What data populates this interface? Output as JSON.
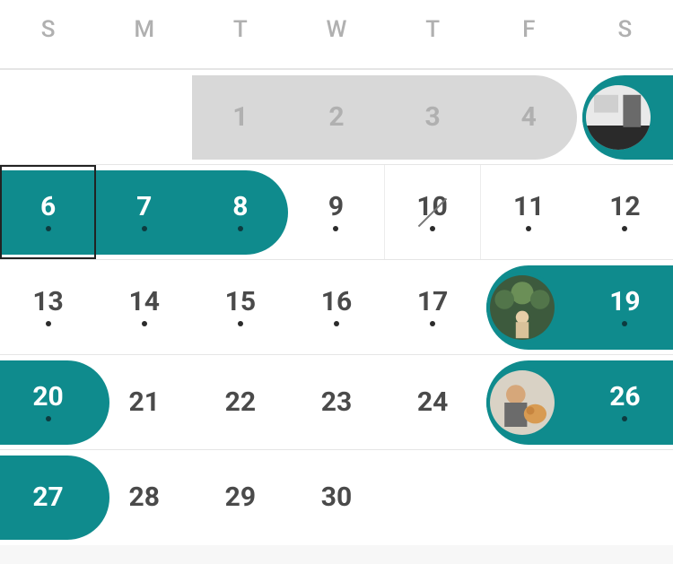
{
  "accentColor": "#0f8b8d",
  "weekdays": [
    "S",
    "M",
    "T",
    "W",
    "T",
    "F",
    "S"
  ],
  "rows": [
    {
      "cells": [
        {
          "num": null,
          "hasDot": false,
          "sel": false,
          "prev": false,
          "strike": false,
          "today": false,
          "sep": false
        },
        {
          "num": null,
          "hasDot": false,
          "sel": false,
          "prev": false,
          "strike": false,
          "today": false,
          "sep": false
        },
        {
          "num": "1",
          "hasDot": false,
          "sel": false,
          "prev": true,
          "strike": false,
          "today": false,
          "sep": false
        },
        {
          "num": "2",
          "hasDot": false,
          "sel": false,
          "prev": true,
          "strike": false,
          "today": false,
          "sep": false
        },
        {
          "num": "3",
          "hasDot": false,
          "sel": false,
          "prev": true,
          "strike": false,
          "today": false,
          "sep": false
        },
        {
          "num": "4",
          "hasDot": false,
          "sel": false,
          "prev": true,
          "strike": false,
          "today": false,
          "sep": false
        },
        {
          "num": null,
          "hasDot": false,
          "sel": false,
          "prev": false,
          "strike": false,
          "today": false,
          "sep": false
        }
      ],
      "pills": [
        {
          "startCol": 2,
          "endCol": 5,
          "color": "grey",
          "roundRight": true,
          "roundLeft": false,
          "avatar": null
        },
        {
          "startCol": 6,
          "endCol": 6,
          "color": "accent",
          "roundRight": false,
          "roundLeft": true,
          "fullRight": true,
          "avatar": "kitchen"
        }
      ]
    },
    {
      "cells": [
        {
          "num": "6",
          "hasDot": true,
          "sel": true,
          "prev": false,
          "strike": false,
          "today": true,
          "sep": false
        },
        {
          "num": "7",
          "hasDot": true,
          "sel": true,
          "prev": false,
          "strike": false,
          "today": false,
          "sep": false
        },
        {
          "num": "8",
          "hasDot": true,
          "sel": true,
          "prev": false,
          "strike": false,
          "today": false,
          "sep": false
        },
        {
          "num": "9",
          "hasDot": true,
          "sel": false,
          "prev": false,
          "strike": false,
          "today": false,
          "sep": true
        },
        {
          "num": "10",
          "hasDot": true,
          "sel": false,
          "prev": false,
          "strike": true,
          "today": false,
          "sep": true
        },
        {
          "num": "11",
          "hasDot": true,
          "sel": false,
          "prev": false,
          "strike": false,
          "today": false,
          "sep": false
        },
        {
          "num": "12",
          "hasDot": true,
          "sel": false,
          "prev": false,
          "strike": false,
          "today": false,
          "sep": false
        }
      ],
      "pills": [
        {
          "startCol": 0,
          "endCol": 2,
          "color": "accent",
          "roundRight": true,
          "roundLeft": false,
          "avatar": null
        }
      ]
    },
    {
      "cells": [
        {
          "num": "13",
          "hasDot": true,
          "sel": false,
          "prev": false,
          "strike": false,
          "today": false,
          "sep": false
        },
        {
          "num": "14",
          "hasDot": true,
          "sel": false,
          "prev": false,
          "strike": false,
          "today": false,
          "sep": false
        },
        {
          "num": "15",
          "hasDot": true,
          "sel": false,
          "prev": false,
          "strike": false,
          "today": false,
          "sep": false
        },
        {
          "num": "16",
          "hasDot": true,
          "sel": false,
          "prev": false,
          "strike": false,
          "today": false,
          "sep": false
        },
        {
          "num": "17",
          "hasDot": true,
          "sel": false,
          "prev": false,
          "strike": false,
          "today": false,
          "sep": false
        },
        {
          "num": null,
          "hasDot": true,
          "sel": true,
          "prev": false,
          "strike": false,
          "today": false,
          "sep": false
        },
        {
          "num": "19",
          "hasDot": true,
          "sel": true,
          "prev": false,
          "strike": false,
          "today": false,
          "sep": false
        }
      ],
      "pills": [
        {
          "startCol": 5,
          "endCol": 6,
          "color": "accent",
          "roundRight": false,
          "roundLeft": true,
          "fullRight": true,
          "avatar": "outdoor"
        }
      ]
    },
    {
      "cells": [
        {
          "num": "20",
          "hasDot": true,
          "sel": true,
          "prev": false,
          "strike": false,
          "today": false,
          "sep": false
        },
        {
          "num": "21",
          "hasDot": false,
          "sel": false,
          "prev": false,
          "strike": false,
          "today": false,
          "sep": false
        },
        {
          "num": "22",
          "hasDot": false,
          "sel": false,
          "prev": false,
          "strike": false,
          "today": false,
          "sep": false
        },
        {
          "num": "23",
          "hasDot": false,
          "sel": false,
          "prev": false,
          "strike": false,
          "today": false,
          "sep": false
        },
        {
          "num": "24",
          "hasDot": false,
          "sel": false,
          "prev": false,
          "strike": false,
          "today": false,
          "sep": false
        },
        {
          "num": null,
          "hasDot": true,
          "sel": true,
          "prev": false,
          "strike": false,
          "today": false,
          "sep": false
        },
        {
          "num": "26",
          "hasDot": true,
          "sel": true,
          "prev": false,
          "strike": false,
          "today": false,
          "sep": false
        }
      ],
      "pills": [
        {
          "startCol": 0,
          "endCol": 0,
          "color": "accent",
          "roundRight": true,
          "roundLeft": false,
          "avatar": null,
          "extend": 15
        },
        {
          "startCol": 5,
          "endCol": 6,
          "color": "accent",
          "roundRight": false,
          "roundLeft": true,
          "fullRight": true,
          "avatar": "person"
        }
      ]
    },
    {
      "cells": [
        {
          "num": "27",
          "hasDot": false,
          "sel": true,
          "prev": false,
          "strike": false,
          "today": false,
          "sep": false
        },
        {
          "num": "28",
          "hasDot": false,
          "sel": false,
          "prev": false,
          "strike": false,
          "today": false,
          "sep": false
        },
        {
          "num": "29",
          "hasDot": false,
          "sel": false,
          "prev": false,
          "strike": false,
          "today": false,
          "sep": false
        },
        {
          "num": "30",
          "hasDot": false,
          "sel": false,
          "prev": false,
          "strike": false,
          "today": false,
          "sep": false
        },
        {
          "num": null,
          "hasDot": false,
          "sel": false,
          "prev": false,
          "strike": false,
          "today": false,
          "sep": false
        },
        {
          "num": null,
          "hasDot": false,
          "sel": false,
          "prev": false,
          "strike": false,
          "today": false,
          "sep": false
        },
        {
          "num": null,
          "hasDot": false,
          "sel": false,
          "prev": false,
          "strike": false,
          "today": false,
          "sep": false
        }
      ],
      "pills": [
        {
          "startCol": 0,
          "endCol": 0,
          "color": "accent",
          "roundRight": true,
          "roundLeft": false,
          "avatar": null,
          "extend": 15
        }
      ]
    }
  ],
  "avatars": {
    "kitchen": {
      "name": "kitchen-photo"
    },
    "outdoor": {
      "name": "outdoor-photo"
    },
    "person": {
      "name": "person-with-pet-photo"
    }
  }
}
